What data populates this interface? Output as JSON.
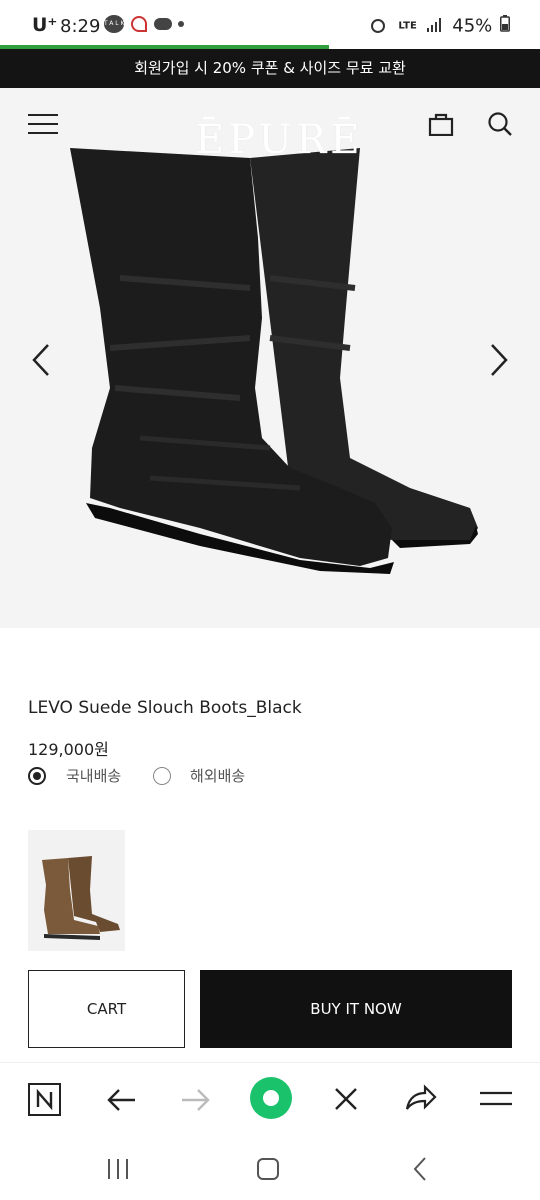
{
  "status_bar": {
    "carrier": "U⁺",
    "time": "8:29",
    "notification_icons": "TALK",
    "network": "LTE",
    "battery": "45%"
  },
  "page_load_progress": 0.61,
  "promo_banner": {
    "text": "회원가입 시 20% 쿠폰 & 사이즈 무료 교환"
  },
  "header": {
    "logo": "ĒPURĒ",
    "menu_icon": "hamburger-icon",
    "bag_icon": "shopping-bag-icon",
    "search_icon": "search-icon"
  },
  "gallery": {
    "prev_icon": "chevron-left-icon",
    "next_icon": "chevron-right-icon"
  },
  "product": {
    "name": "LEVO Suede Slouch Boots_Black",
    "price": "129,000원",
    "shipping_options": [
      {
        "label": "국내배송",
        "selected": true
      },
      {
        "label": "해외배송",
        "selected": false
      }
    ]
  },
  "actions": {
    "cart_label": "CART",
    "buy_label": "BUY IT NOW"
  },
  "browser_toolbar": {
    "items": [
      "naver-n-icon",
      "back-arrow-icon",
      "forward-arrow-icon",
      "home-dot-icon",
      "close-icon",
      "share-icon",
      "menu-icon"
    ]
  },
  "colors": {
    "accent_green": "#2e9e3f",
    "dark": "#111111",
    "home_green": "#19c26b"
  }
}
